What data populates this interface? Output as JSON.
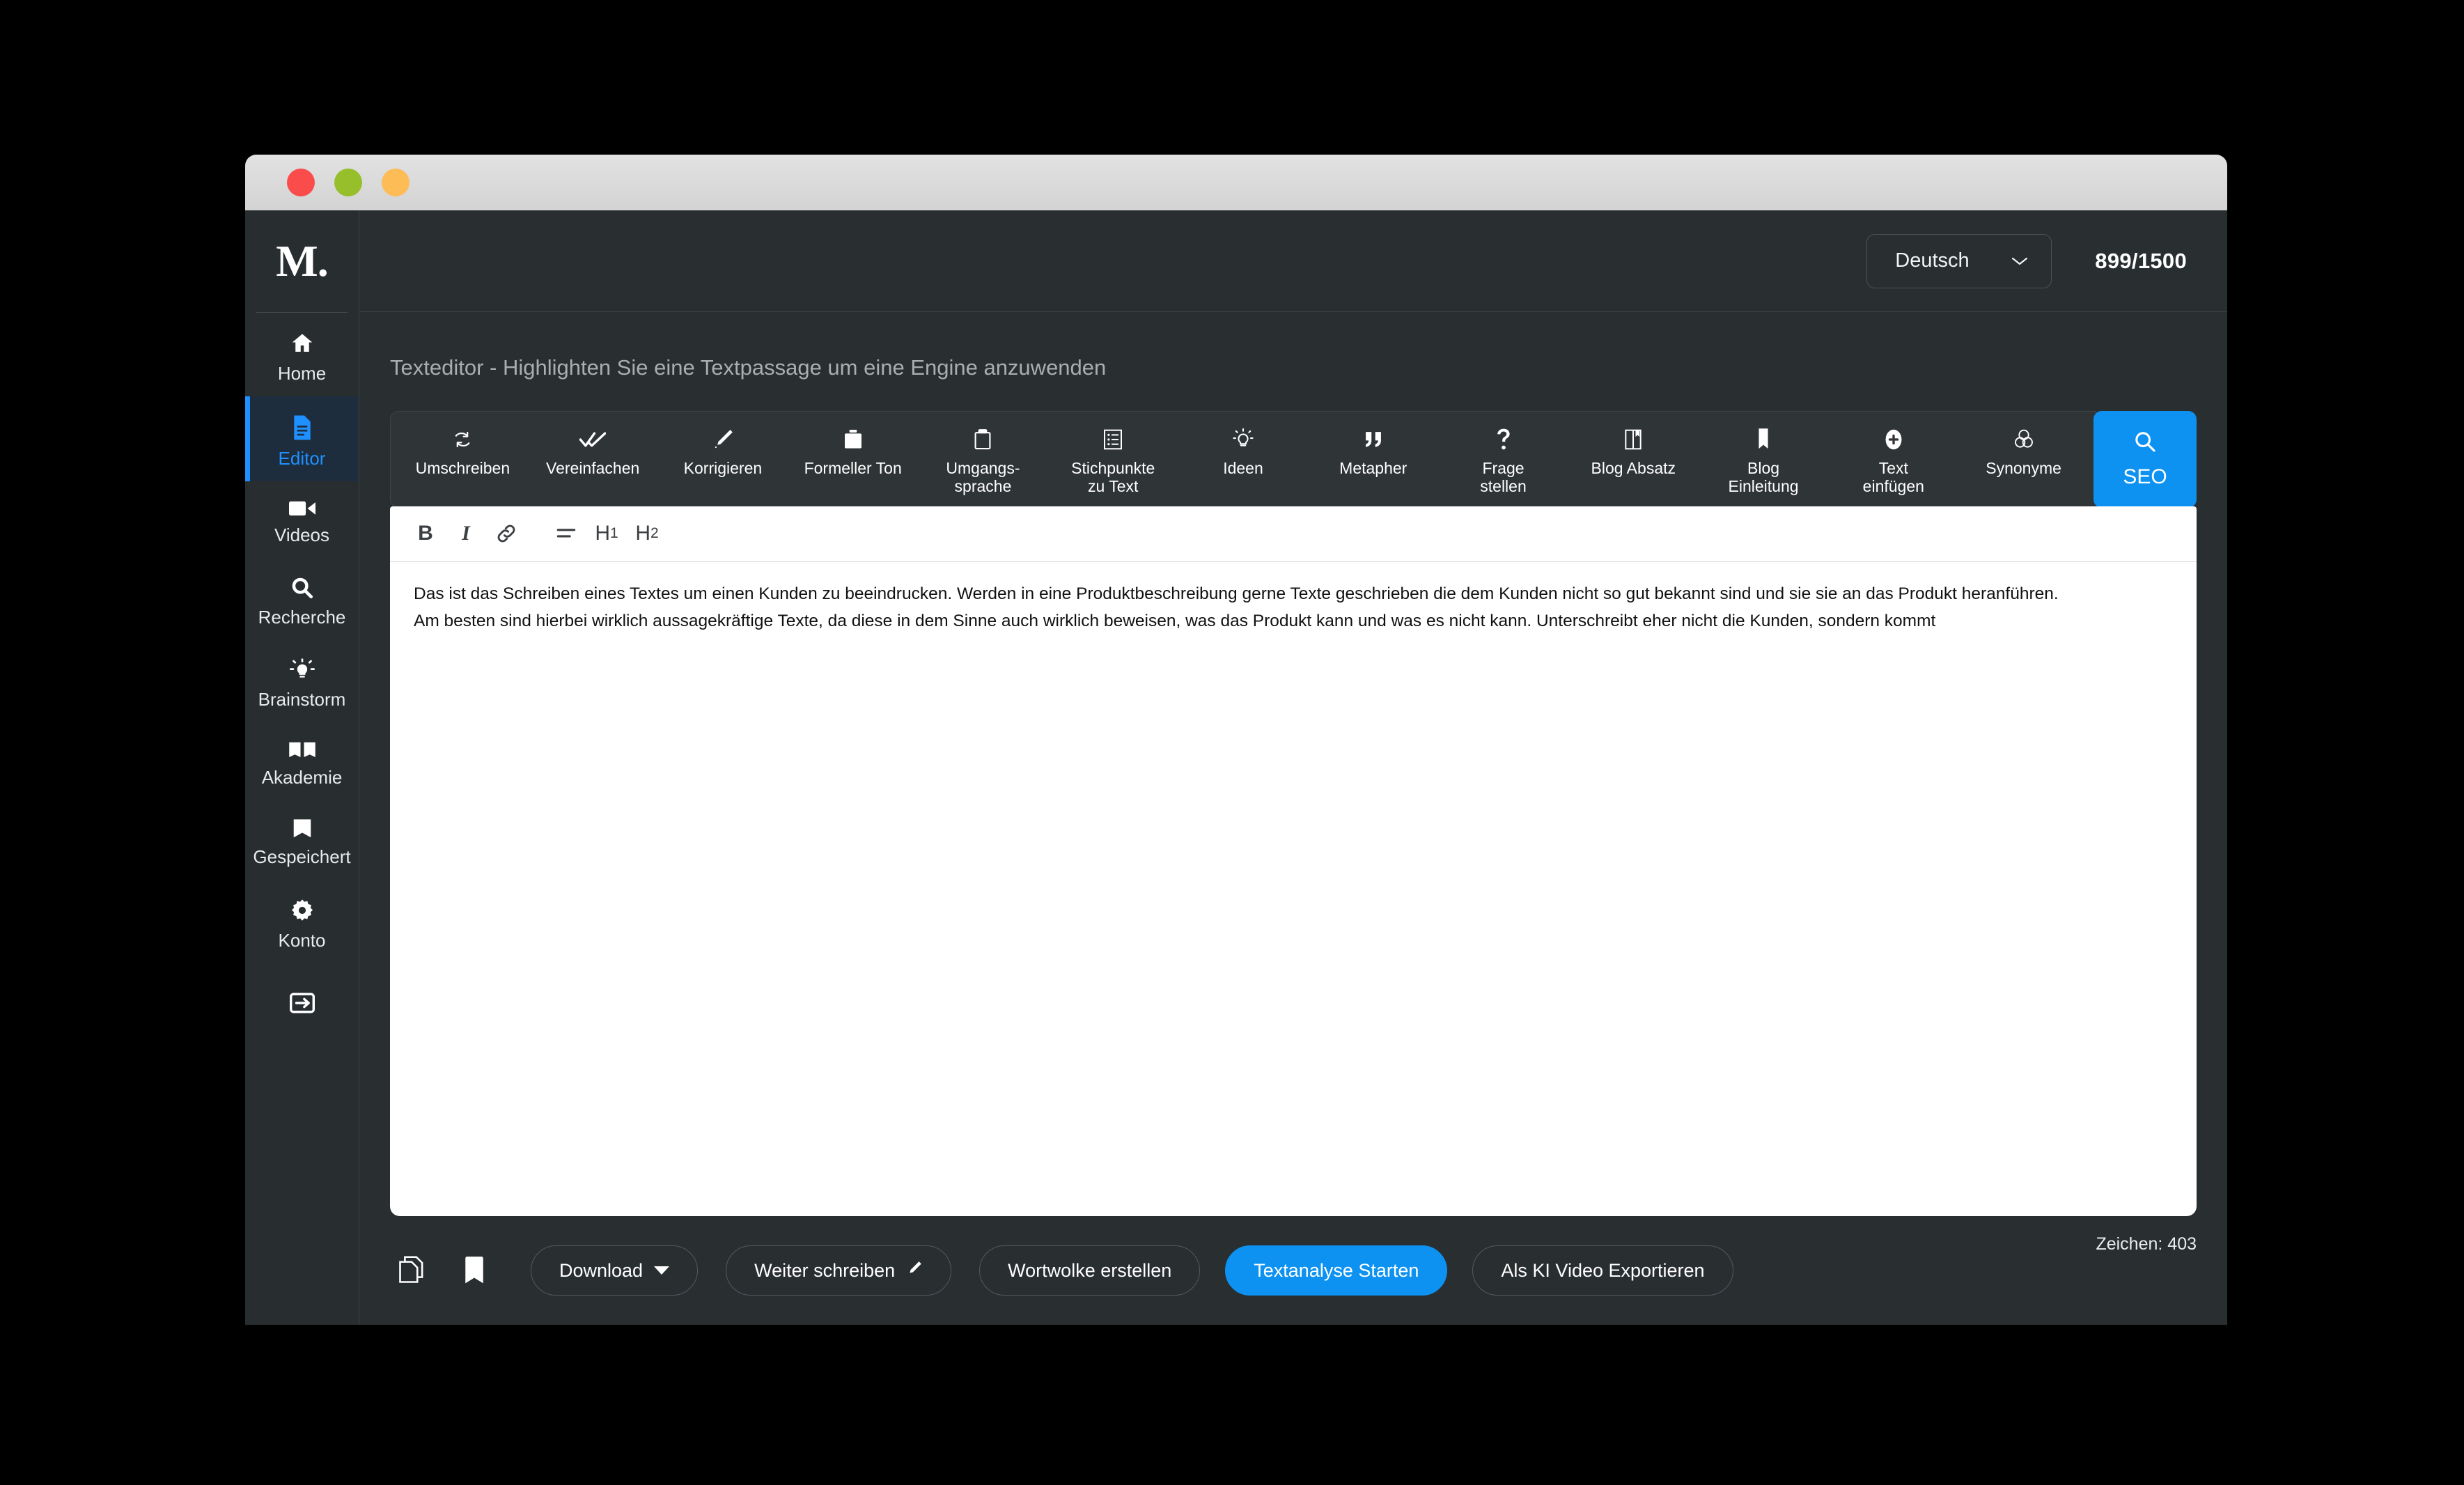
{
  "window": {
    "traffic_lights": [
      {
        "name": "close",
        "color": "#fb4c4c"
      },
      {
        "name": "minimize",
        "color": "#97be2b"
      },
      {
        "name": "maximize",
        "color": "#fdbc56"
      }
    ]
  },
  "brand": {
    "logo_text": "M."
  },
  "sidebar": {
    "items": [
      {
        "label": "Home",
        "icon": "home-icon",
        "active": false
      },
      {
        "label": "Editor",
        "icon": "document-icon",
        "active": true
      },
      {
        "label": "Videos",
        "icon": "video-camera-icon",
        "active": false
      },
      {
        "label": "Recherche",
        "icon": "search-icon",
        "active": false
      },
      {
        "label": "Brainstorm",
        "icon": "lightbulb-icon",
        "active": false
      },
      {
        "label": "Akademie",
        "icon": "open-book-icon",
        "active": false
      },
      {
        "label": "Gespeichert",
        "icon": "bookmark-icon",
        "active": false
      },
      {
        "label": "Konto",
        "icon": "gear-icon",
        "active": false
      }
    ],
    "logout": {
      "icon": "logout-icon"
    },
    "accent_color": "#1e90ff"
  },
  "topbar": {
    "language": {
      "value": "Deutsch",
      "icon": "chevron-down-icon"
    },
    "quota": "899/1500"
  },
  "page": {
    "title": "Texteditor - Highlighten Sie eine Textpassage um eine Engine anzuwenden"
  },
  "engines": [
    {
      "label": "Umschreiben",
      "icon": "refresh-cycle-icon"
    },
    {
      "label": "Vereinfachen",
      "icon": "double-check-icon"
    },
    {
      "label": "Korrigieren",
      "icon": "pencil-icon"
    },
    {
      "label": "Formeller Ton",
      "icon": "briefcase-icon"
    },
    {
      "label": "Umgangs-\nsprache",
      "icon": "clipboard-icon"
    },
    {
      "label": "Stichpunkte\nzu Text",
      "icon": "list-icon"
    },
    {
      "label": "Ideen",
      "icon": "lightbulb-icon"
    },
    {
      "label": "Metapher",
      "icon": "quote-icon"
    },
    {
      "label": "Frage\nstellen",
      "icon": "question-mark-icon"
    },
    {
      "label": "Blog Absatz",
      "icon": "book-bookmark-icon"
    },
    {
      "label": "Blog\nEinleitung",
      "icon": "bookmark-ribbon-icon"
    },
    {
      "label": "Text\neinfügen",
      "icon": "plus-circle-icon"
    },
    {
      "label": "Synonyme",
      "icon": "venn-circles-icon"
    }
  ],
  "seo_button": {
    "label": "SEO",
    "icon": "search-icon",
    "color": "#0d92f2"
  },
  "format_bar": [
    {
      "name": "bold-button",
      "glyph": "B"
    },
    {
      "name": "italic-button",
      "glyph": "I"
    },
    {
      "name": "link-button",
      "glyph": "link-icon"
    },
    {
      "name": "align-button",
      "glyph": "align-icon"
    },
    {
      "name": "heading-1-button",
      "glyph": "H",
      "sub": "1"
    },
    {
      "name": "heading-2-button",
      "glyph": "H",
      "sub": "2"
    }
  ],
  "document": {
    "paragraph_1": "Das ist das Schreiben eines Textes um einen Kunden zu beeindrucken. Werden in eine Produktbeschreibung gerne Texte geschrieben die dem Kunden nicht so gut bekannt sind und sie sie an das Produkt heranführen.",
    "paragraph_2": "Am besten sind hierbei wirklich aussagekräftige Texte, da diese in dem Sinne auch wirklich beweisen, was das Produkt kann und was es nicht kann. Unterschreibt eher nicht die Kunden, sondern kommt"
  },
  "actionbar": {
    "copy_icon": "copy-document-icon",
    "bookmark_icon": "bookmark-icon",
    "download_label": "Download",
    "continue_label": "Weiter schreiben",
    "wordcloud_label": "Wortwolke erstellen",
    "analyze_label": "Textanalyse Starten",
    "export_label": "Als KI Video Exportieren",
    "char_count": "Zeichen: 403"
  }
}
